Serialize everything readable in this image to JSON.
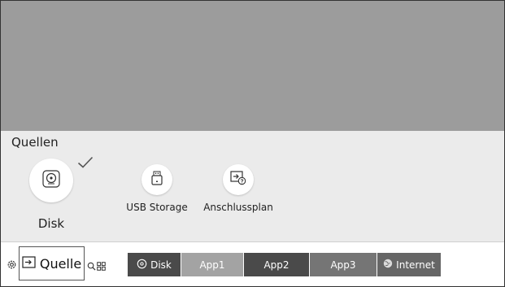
{
  "sources": {
    "title": "Quellen",
    "items": [
      {
        "label": "Disk",
        "icon": "disc-icon",
        "selected": true
      },
      {
        "label": "USB Storage",
        "icon": "usb-drive-icon"
      },
      {
        "label": "Anschlussplan",
        "icon": "connection-guide-icon"
      }
    ]
  },
  "bottom_bar": {
    "settings_icon": "gear-icon",
    "source_label": "Quelle",
    "search_icon": "search-icon",
    "apps_icon": "grid-icon",
    "tabs": [
      {
        "label": "Disk",
        "icon": "disc-icon",
        "color": "#4a4a4a"
      },
      {
        "label": "App1",
        "color": "#a3a3a3"
      },
      {
        "label": "App2",
        "color": "#4a4a4a"
      },
      {
        "label": "App3",
        "color": "#757575"
      },
      {
        "label": "Internet",
        "icon": "globe-icon",
        "color": "#666666"
      }
    ]
  }
}
